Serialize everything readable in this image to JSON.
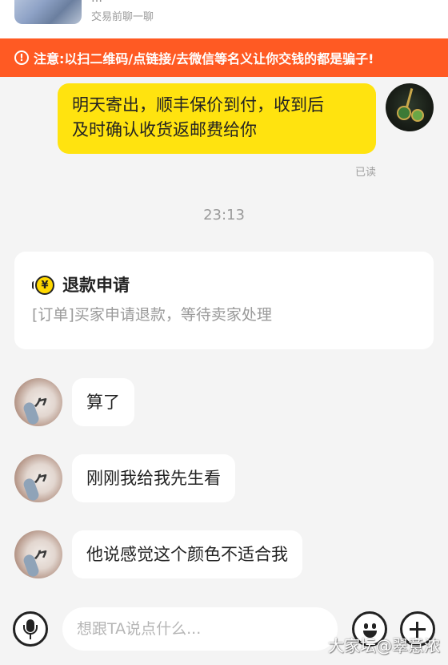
{
  "header": {
    "title": "…",
    "subtitle": "交易前聊一聊"
  },
  "warning": {
    "icon": "exclamation-icon",
    "text": "注意:以扫二维码/点链接/去微信等名义让你交钱的都是骗子!"
  },
  "messages": {
    "self": {
      "text_line1": "明天寄出，顺丰保价到付，收到后",
      "text_line2": "及时确认收货返邮费给你",
      "status": "已读"
    },
    "timestamp": "23:13",
    "refund_card": {
      "icon": "refund-coin-icon",
      "title": "退款申请",
      "description": "[订单]买家申请退款，等待卖家处理"
    },
    "peer": [
      {
        "text": "算了"
      },
      {
        "text": "刚刚我给我先生看"
      },
      {
        "text": "他说感觉这个颜色不适合我"
      }
    ]
  },
  "input_bar": {
    "placeholder": "想跟TA说点什么...",
    "value": ""
  },
  "watermark": "大家坛@翠意浓",
  "colors": {
    "accent_yellow": "#ffe30f",
    "warning_orange": "#ff5a23",
    "background": "#f4f4f4"
  }
}
